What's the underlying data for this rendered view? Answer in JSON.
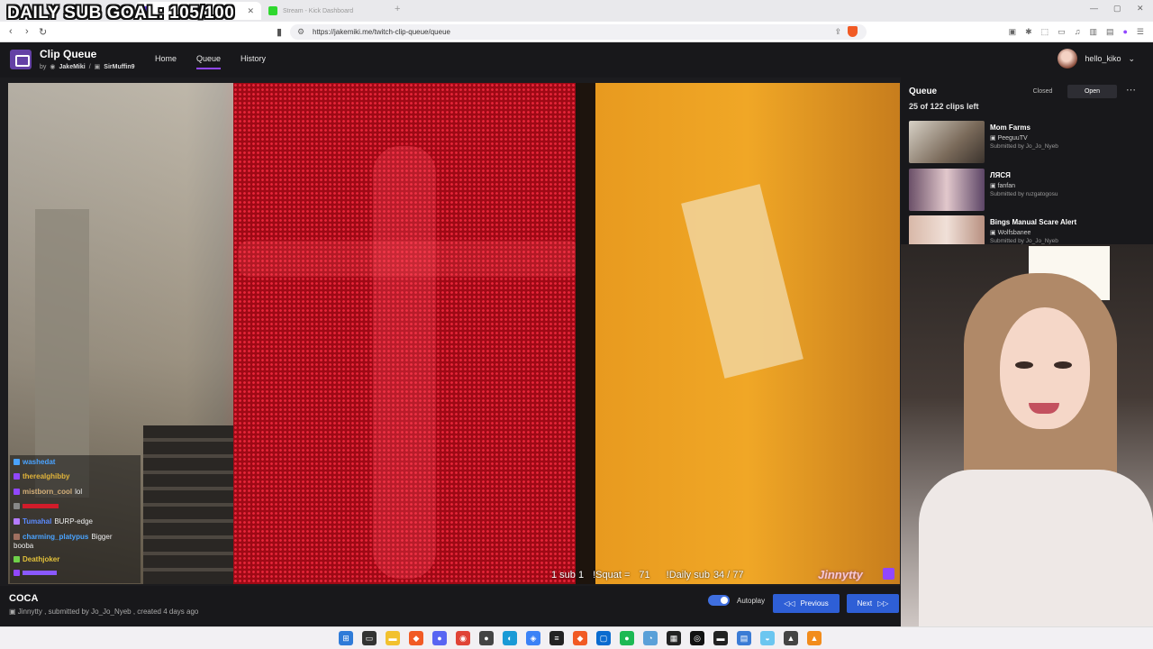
{
  "overlay": {
    "goal_text": "DAILY SUB GOAL: 105/100"
  },
  "browser": {
    "tabs": [
      {
        "label": "",
        "active": true
      },
      {
        "label": "Stream - Kick Dashboard",
        "active": false
      }
    ],
    "url": "https://jakemiki.me/twitch-clip-queue/queue"
  },
  "app": {
    "title": "Clip Queue",
    "by_prefix": "by",
    "author1": "JakeMiki",
    "author_sep": "/",
    "author2": "SirMuffin9",
    "nav": [
      "Home",
      "Queue",
      "History"
    ],
    "username": "hello_kiko"
  },
  "chat": [
    {
      "user": "washedat",
      "message": "",
      "color": "#4aa3ff"
    },
    {
      "user": "therealghibby",
      "message": "",
      "color": "#e2b53a"
    },
    {
      "user": "mistborn_cool",
      "message": "lol",
      "color": "#d5b07a"
    },
    {
      "user": "",
      "message": "",
      "color": "#d11c2a"
    },
    {
      "user": "Tumahal",
      "message": "BURP-edge",
      "color": "#5b8bff"
    },
    {
      "user": "charming_platypus",
      "message": "Bigger",
      "color": "#4aa3ff"
    },
    {
      "user": "",
      "message": "booba",
      "color": "#ffffff"
    },
    {
      "user": "Deathjoker",
      "message": "",
      "color": "#e2c13a"
    },
    {
      "user": "",
      "message": "",
      "color": "#8a58ff"
    }
  ],
  "stats": {
    "subs": "1 sub 1",
    "squat_label": "!Squat =",
    "squat_value": "71",
    "daily_label": "!Daily sub",
    "daily_value": "34 / 77"
  },
  "brand": "Jinnytty",
  "clip": {
    "title": "COCA",
    "meta": "Jinnytty , submitted by Jo_Jo_Nyeb , created 4 days ago"
  },
  "controls": {
    "autoplay_label": "Autoplay",
    "autoplay_on": true,
    "previous_label": "Previous",
    "next_label": "Next"
  },
  "queue": {
    "title": "Queue",
    "count_text": "25 of 122 clips left",
    "closed_label": "Closed",
    "open_label": "Open",
    "items": [
      {
        "title": "Mom Farms",
        "channel": "PeeguuTV",
        "submitter": "Submitted by Jo_Jo_Nyeb"
      },
      {
        "title": "ЛЯСЯ",
        "channel": "fanfan",
        "submitter": "Submitted by ruzgatogosu"
      },
      {
        "title": "Bings Manual Scare Alert",
        "channel": "Wolfsbanee",
        "submitter": "Submitted by Jo_Jo_Nyeb"
      }
    ]
  },
  "colors": {
    "accent": "#9147ff",
    "button_blue": "#2e5fd6",
    "header_bg": "#18181b"
  },
  "icons": [
    "back-arrow-icon",
    "forward-arrow-icon",
    "reload-icon",
    "bookmark-icon",
    "share-icon",
    "brave-shield-icon",
    "chevron-down-icon",
    "kebab-menu-icon",
    "previous-icon",
    "next-icon"
  ]
}
